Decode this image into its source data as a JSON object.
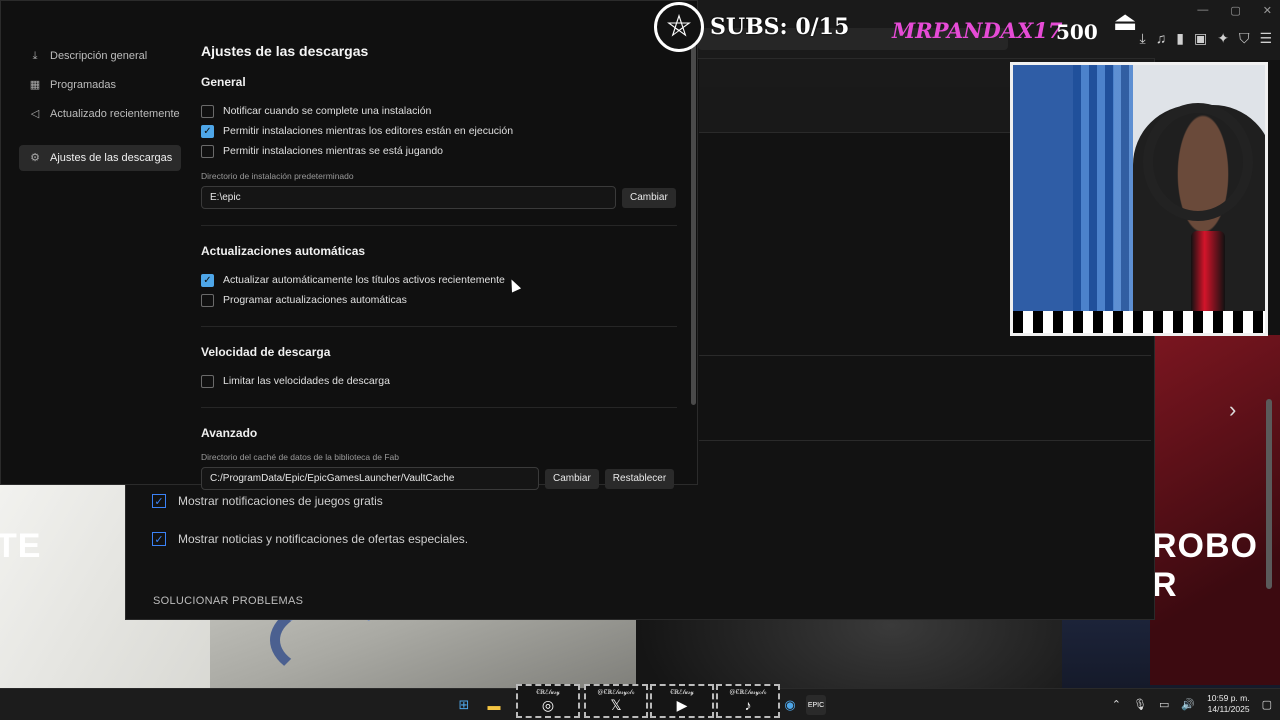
{
  "sidebar": {
    "items": [
      {
        "icon": "download-icon",
        "label": "Descripción general"
      },
      {
        "icon": "calendar-icon",
        "label": "Programadas"
      },
      {
        "icon": "megaphone-icon",
        "label": "Actualizado recientemente"
      },
      {
        "icon": "gear-icon",
        "label": "Ajustes de las descargas",
        "active": true
      }
    ]
  },
  "dialog": {
    "title": "Ajustes de las descargas",
    "general": {
      "heading": "General",
      "options": [
        {
          "label": "Notificar cuando se complete una instalación",
          "checked": false
        },
        {
          "label": "Permitir instalaciones mientras los editores están en ejecución",
          "checked": true
        },
        {
          "label": "Permitir instalaciones mientras se está jugando",
          "checked": false
        }
      ],
      "install_dir_label": "Directorio de instalación predeterminado",
      "install_dir_value": "E:\\epic",
      "change_button": "Cambiar"
    },
    "auto_updates": {
      "heading": "Actualizaciones automáticas",
      "options": [
        {
          "label": "Actualizar automáticamente los títulos activos recientemente",
          "checked": true
        },
        {
          "label": "Programar actualizaciones automáticas",
          "checked": false
        }
      ]
    },
    "speed": {
      "heading": "Velocidad de descarga",
      "options": [
        {
          "label": "Limitar las velocidades de descarga",
          "checked": false
        }
      ]
    },
    "advanced": {
      "heading": "Avanzado",
      "cache_dir_label": "Directorio del caché de datos de la biblioteca de Fab",
      "cache_dir_value": "C:/ProgramData/Epic/EpicGamesLauncher/VaultCache",
      "change_button": "Cambiar",
      "reset_button": "Restablecer"
    }
  },
  "background_settings": {
    "options": [
      {
        "label": "Mostrar notificaciones de juegos gratis",
        "checked": true
      },
      {
        "label": "Mostrar noticias y notificaciones de ofertas especiales.",
        "checked": true
      }
    ],
    "troubleshoot": "SOLUCIONAR PROBLEMAS"
  },
  "hero": {
    "left_text": "TE",
    "right_text": "ROBO R"
  },
  "overlay": {
    "subs": "SUBS: 0/15",
    "donor_name": "MRPANDAX17",
    "donor_amount": "500"
  },
  "socials": [
    {
      "name": "€ℝℰ𝓁𝓊𝓈𝓎",
      "icon": "instagram-icon",
      "glyph": "◎"
    },
    {
      "name": "@€ℝℰ𝓁𝓊𝓈𝓎ℴ𝓁ℴ",
      "icon": "x-icon",
      "glyph": "𝕏"
    },
    {
      "name": "€ℝℰ𝓁𝓊𝓈𝓎",
      "icon": "youtube-icon",
      "glyph": "▶"
    },
    {
      "name": "@€ℝℰ𝓁𝓊𝓈𝓎ℴ𝓁ℴ",
      "icon": "tiktok-icon",
      "glyph": "♪"
    }
  ],
  "taskbar": {
    "time": "10:59 p. m.",
    "date": "14/11/2025"
  },
  "colors": {
    "accent": "#4ea6e8",
    "donor": "#e64bd6"
  }
}
